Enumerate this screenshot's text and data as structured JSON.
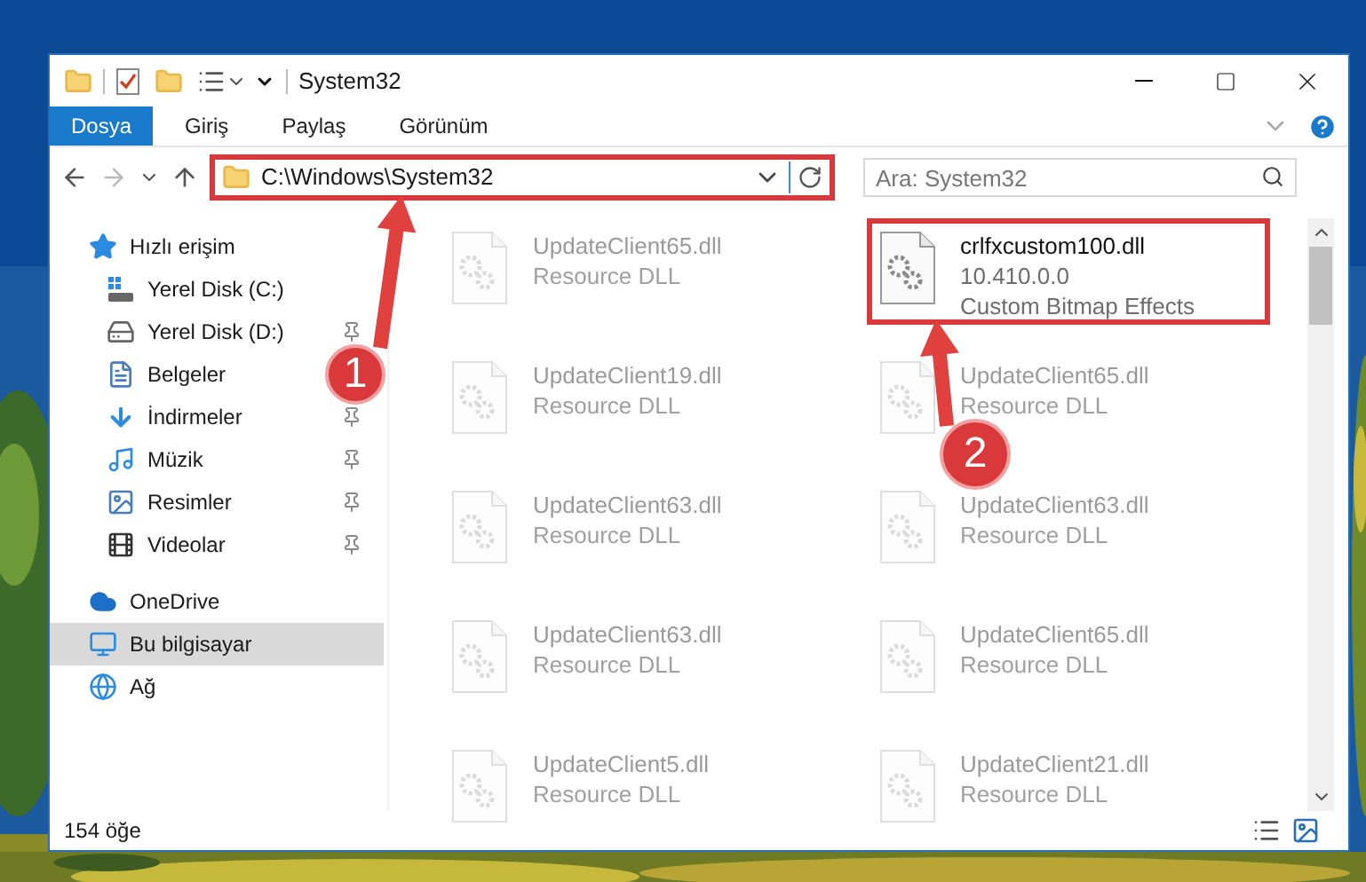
{
  "window": {
    "title": "System32"
  },
  "ribbon_tabs": [
    {
      "label": "Dosya",
      "selected": true
    },
    {
      "label": "Giriş",
      "selected": false
    },
    {
      "label": "Paylaş",
      "selected": false
    },
    {
      "label": "Görünüm",
      "selected": false
    }
  ],
  "address": {
    "path": "C:\\Windows\\System32",
    "highlighted": true
  },
  "search": {
    "placeholder": "Ara: System32"
  },
  "sidebar": {
    "items": [
      {
        "label": "Hızlı erişim",
        "kind": "star",
        "selected": false,
        "pinned": false,
        "children": [
          {
            "label": "Yerel Disk (C:)",
            "kind": "drive-win",
            "selected": false,
            "pinned": false
          },
          {
            "label": "Yerel Disk (D:)",
            "kind": "drive",
            "selected": false,
            "pinned": true
          },
          {
            "label": "Belgeler",
            "kind": "document",
            "selected": false,
            "pinned": false
          },
          {
            "label": "İndirmeler",
            "kind": "download",
            "selected": false,
            "pinned": true
          },
          {
            "label": "Müzik",
            "kind": "music",
            "selected": false,
            "pinned": true
          },
          {
            "label": "Resimler",
            "kind": "pictures",
            "selected": false,
            "pinned": true
          },
          {
            "label": "Videolar",
            "kind": "video",
            "selected": false,
            "pinned": true
          }
        ]
      },
      {
        "label": "OneDrive",
        "kind": "cloud",
        "selected": false,
        "pinned": false
      },
      {
        "label": "Bu bilgisayar",
        "kind": "computer",
        "selected": true,
        "pinned": false
      },
      {
        "label": "Ağ",
        "kind": "network",
        "selected": false,
        "pinned": false
      }
    ]
  },
  "files": [
    {
      "name": "UpdateClient65.dll",
      "details": [
        "Resource DLL"
      ],
      "blurred": true,
      "highlighted": false
    },
    {
      "name": "crlfxcustom100.dll",
      "details": [
        "10.410.0.0",
        "Custom Bitmap Effects"
      ],
      "blurred": false,
      "highlighted": true
    },
    {
      "name": "UpdateClient19.dll",
      "details": [
        "Resource DLL"
      ],
      "blurred": true,
      "highlighted": false
    },
    {
      "name": "UpdateClient65.dll",
      "details": [
        "Resource DLL"
      ],
      "blurred": true,
      "highlighted": false
    },
    {
      "name": "UpdateClient63.dll",
      "details": [
        "Resource DLL"
      ],
      "blurred": true,
      "highlighted": false
    },
    {
      "name": "UpdateClient63.dll",
      "details": [
        "Resource DLL"
      ],
      "blurred": true,
      "highlighted": false
    },
    {
      "name": "UpdateClient63.dll",
      "details": [
        "Resource DLL"
      ],
      "blurred": true,
      "highlighted": false
    },
    {
      "name": "UpdateClient65.dll",
      "details": [
        "Resource DLL"
      ],
      "blurred": true,
      "highlighted": false
    },
    {
      "name": "UpdateClient5.dll",
      "details": [
        "Resource DLL"
      ],
      "blurred": true,
      "highlighted": false
    },
    {
      "name": "UpdateClient21.dll",
      "details": [
        "Resource DLL"
      ],
      "blurred": true,
      "highlighted": false
    }
  ],
  "status_bar": {
    "count": "154 öğe"
  },
  "annotations": [
    {
      "label": "1"
    },
    {
      "label": "2"
    }
  ]
}
